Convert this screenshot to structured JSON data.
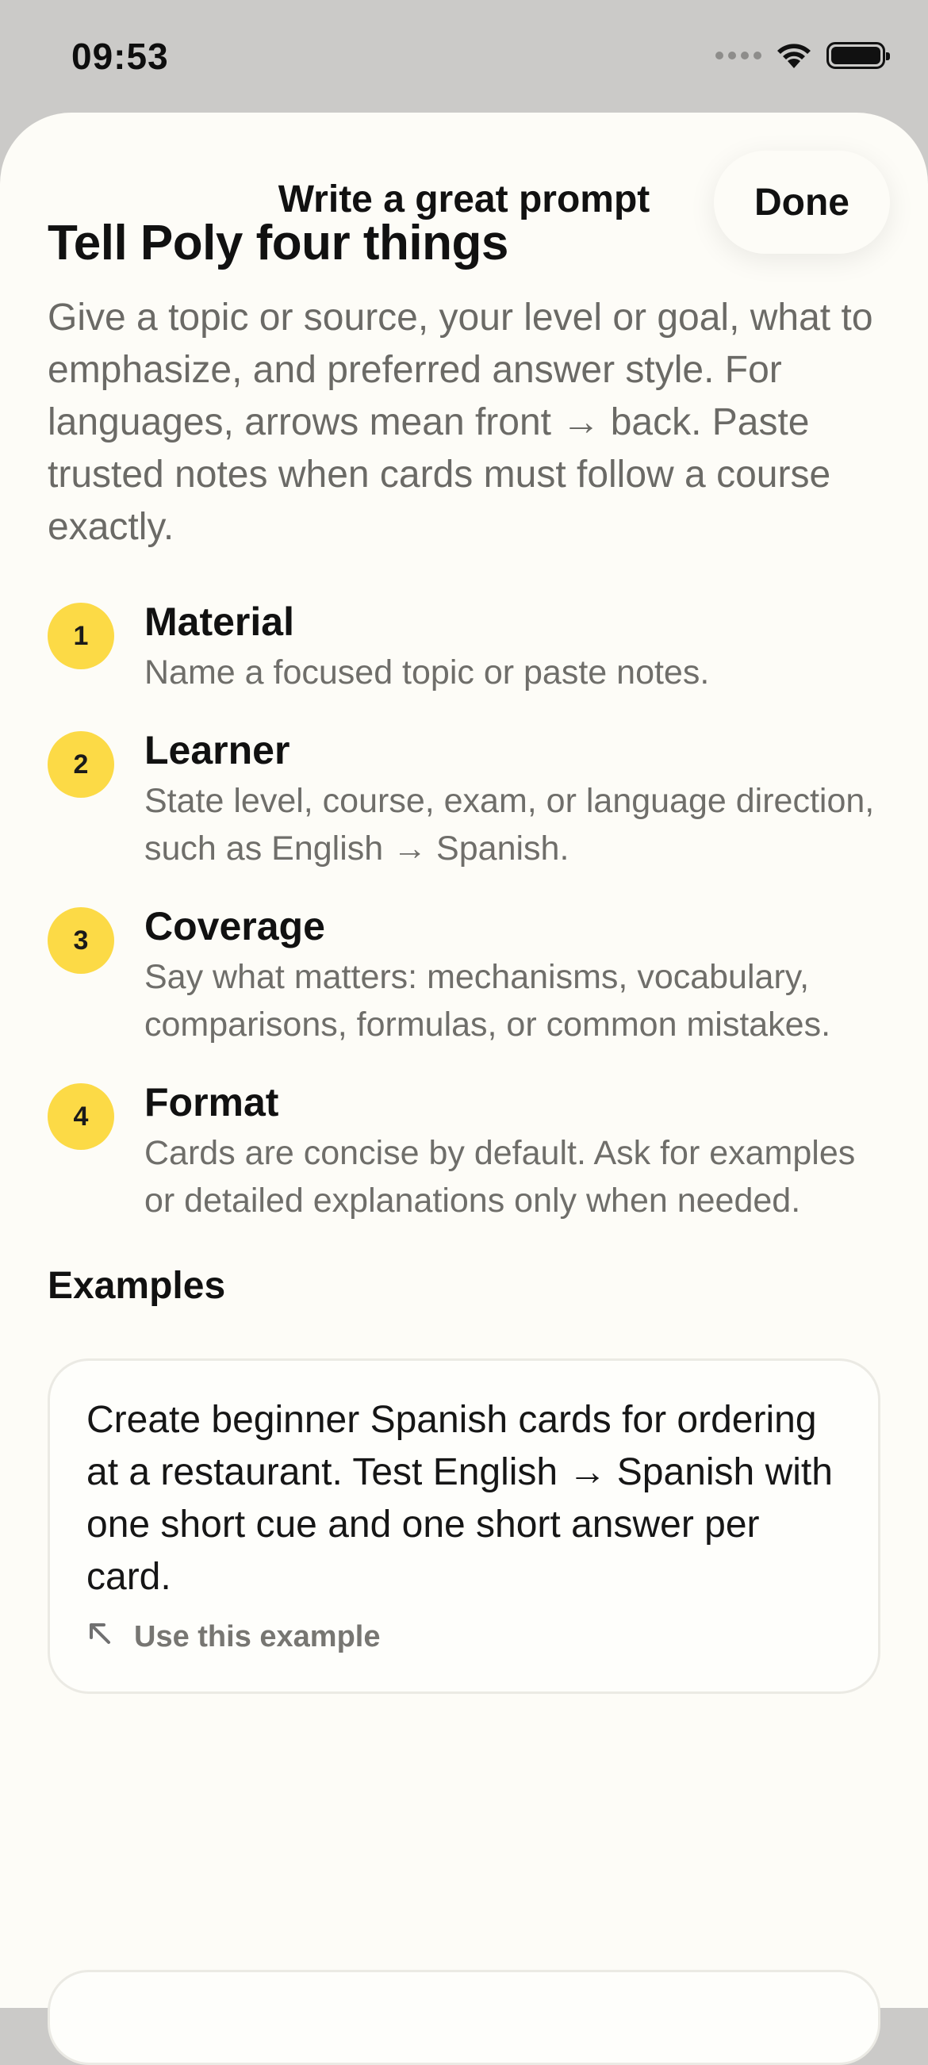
{
  "status": {
    "time": "09:53"
  },
  "header": {
    "title": "Write a great prompt",
    "done_label": "Done"
  },
  "content": {
    "headline": "Tell Poly four things",
    "intro": "Give a topic or source, your level or goal, what to emphasize, and preferred answer style. For languages, arrows mean front → back. Paste trusted notes when cards must follow a course exactly.",
    "steps": [
      {
        "num": "1",
        "title": "Material",
        "desc": "Name a focused topic or paste notes."
      },
      {
        "num": "2",
        "title": "Learner",
        "desc": "State level, course, exam, or language direction, such as English → Spanish."
      },
      {
        "num": "3",
        "title": "Coverage",
        "desc": "Say what matters: mechanisms, vocabulary, comparisons, formulas, or common mistakes."
      },
      {
        "num": "4",
        "title": "Format",
        "desc": "Cards are concise by default. Ask for examples or detailed explanations only when needed."
      }
    ],
    "examples_label": "Examples",
    "examples": [
      {
        "text": "Create beginner Spanish cards for ordering at a restaurant. Test English → Spanish with one short cue and one short answer per card.",
        "action": "Use this example"
      }
    ]
  },
  "colors": {
    "accent": "#fcda46",
    "background": "#fdfcf7",
    "status_bar": "#cbcac8"
  }
}
